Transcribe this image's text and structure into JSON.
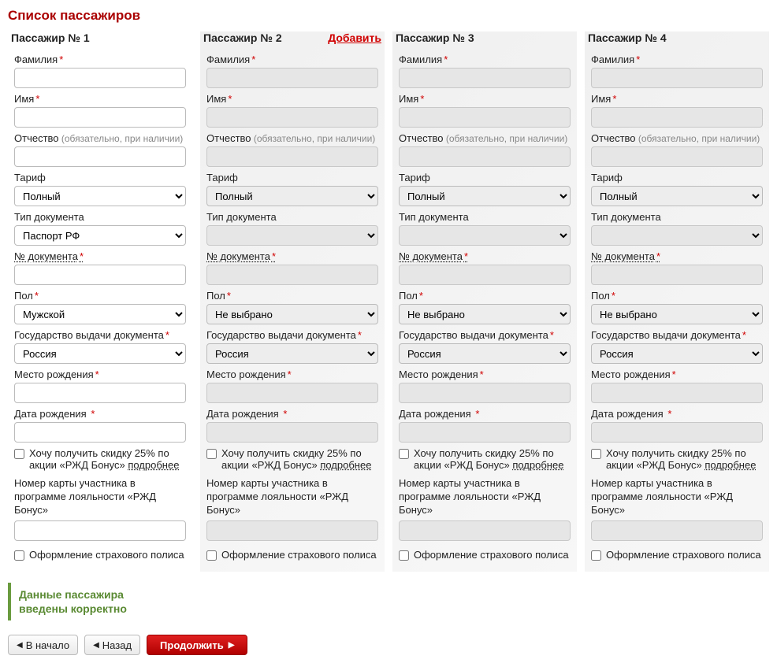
{
  "title": "Список пассажиров",
  "labels": {
    "surname": "Фамилия",
    "name": "Имя",
    "patronymic": "Отчество",
    "patronymic_note": " (обязательно, при наличии)",
    "tariff": "Тариф",
    "doc_type": "Тип документа",
    "doc_number": "№ документа",
    "gender": "Пол",
    "issue_country": "Государство выдачи документа",
    "birthplace": "Место рождения",
    "birthdate": "Дата рождения ",
    "bonus_checkbox": "Хочу получить скидку 25% по акции «РЖД Бонус» ",
    "more": "подробнее",
    "loyalty": "Номер карты участника в программе лояльности «РЖД Бонус»",
    "insurance": "Оформление страхового полиса"
  },
  "passengers": [
    {
      "header": "Пассажир № 1",
      "add": false,
      "disabled": false,
      "values": {
        "surname": "",
        "name": "",
        "patronymic": "",
        "tariff": "Полный",
        "doc_type": "Паспорт РФ",
        "doc_number": "",
        "gender": "Мужской",
        "issue_country": "Россия",
        "birthplace": "",
        "birthdate": "",
        "loyalty": ""
      }
    },
    {
      "header": "Пассажир № 2",
      "add": true,
      "disabled": true,
      "values": {
        "tariff": "Полный",
        "doc_type": "",
        "gender": "Не выбрано",
        "issue_country": "Россия"
      }
    },
    {
      "header": "Пассажир № 3",
      "add": false,
      "disabled": true,
      "values": {
        "tariff": "Полный",
        "doc_type": "",
        "gender": "Не выбрано",
        "issue_country": "Россия"
      }
    },
    {
      "header": "Пассажир № 4",
      "add": false,
      "disabled": true,
      "values": {
        "tariff": "Полный",
        "doc_type": "",
        "gender": "Не выбрано",
        "issue_country": "Россия"
      }
    }
  ],
  "validation": {
    "line1": "Данные пассажира",
    "line2": "введены корректно"
  },
  "nav": {
    "start": "В начало",
    "back": "Назад",
    "continue": "Продолжить"
  },
  "add_text": "Добавить"
}
